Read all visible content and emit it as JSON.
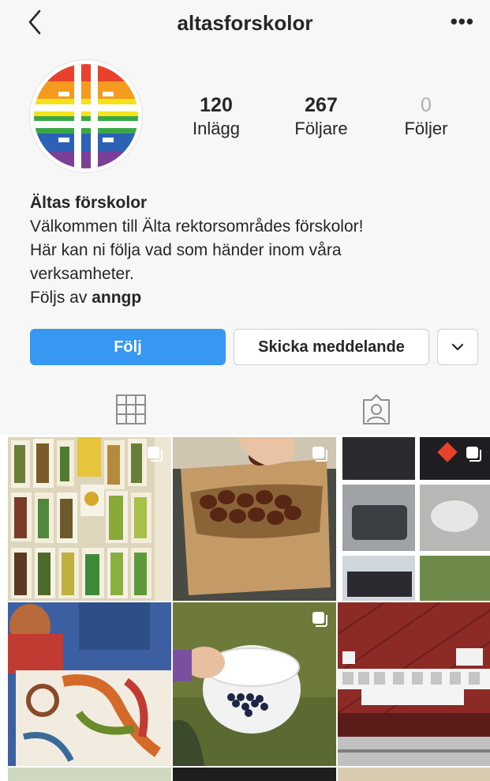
{
  "header": {
    "username": "altasforskolor"
  },
  "stats": [
    {
      "value": "120",
      "label": "Inlägg"
    },
    {
      "value": "267",
      "label": "Följare"
    },
    {
      "value": "0",
      "label": "Följer"
    }
  ],
  "bio": {
    "name": "Ältas förskolor",
    "line1": "Välkommen till Älta rektorsområdes förskolor!",
    "line2": "Här kan ni följa vad som händer inom våra",
    "line3": "verksamheter.",
    "followed_by_prefix": "Följs av",
    "followed_by_user": "anngp"
  },
  "actions": {
    "follow": "Följ",
    "message": "Skicka meddelande"
  },
  "tabs": [
    {
      "icon": "grid-icon"
    },
    {
      "icon": "tagged-icon"
    }
  ],
  "colors": {
    "follow_button": "#3897f0",
    "text": "#262626",
    "panel_bg": "#f7f7f7"
  },
  "posts": [
    {
      "description": "children's paintings with sunflowers",
      "multi": true
    },
    {
      "description": "paper bag of chestnuts",
      "multi": true
    },
    {
      "description": "library bus collage",
      "multi": true
    },
    {
      "description": "children painting on paper",
      "multi": false
    },
    {
      "description": "bowl of blueberries",
      "multi": true
    },
    {
      "description": "red wall with sign board",
      "multi": false
    }
  ]
}
